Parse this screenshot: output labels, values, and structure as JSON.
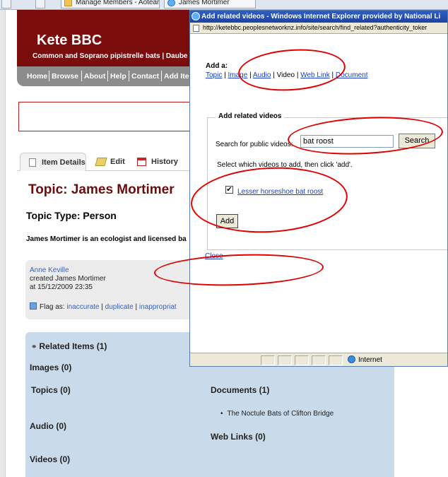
{
  "browser_tabs": [
    {
      "label": "Manage Members - Aotearoa..."
    },
    {
      "label": "James Mortimer"
    }
  ],
  "site": {
    "title": "Kete BBC",
    "subtitle": "Common and Soprano pipistrelle bats | Daube",
    "nav": [
      "Home",
      "Browse",
      "About",
      "Help",
      "Contact",
      "Add Ite"
    ]
  },
  "page_tabs": {
    "details": "Item Details",
    "edit": "Edit",
    "history": "History"
  },
  "topic": {
    "title": "Topic: James Mortimer",
    "type": "Topic Type: Person",
    "description": "James Mortimer is an ecologist and licensed ba"
  },
  "creator": {
    "author": "Anne Keville",
    "created": "created James Mortimer",
    "date": "at 15/12/2009 23:35",
    "flag_label": "Flag as:",
    "flags": [
      "inaccurate",
      "duplicate",
      "inappropriat"
    ]
  },
  "related": {
    "heading": "Related Items (1)",
    "images": "Images (0)",
    "topics": "Topics (0)",
    "audio": "Audio (0)",
    "videos": "Videos (0)",
    "documents": "Documents (1)",
    "document_item": "The Noctule Bats of Clifton Bridge",
    "web_links": "Web Links (0)"
  },
  "popup": {
    "title": "Add related videos - Windows Internet Explorer provided by National Li",
    "address": "http://ketebbc.peoplesnetworknz.info/site/search/find_related?authenticity_toker",
    "add_a": "Add a:",
    "types": [
      "Topic",
      "Image",
      "Audio",
      "Video",
      "Web Link",
      "Document"
    ],
    "current_type": "Video",
    "legend": "Add related videos",
    "search_label": "Search for public videos:",
    "search_value": "bat roost",
    "search_button": "Search",
    "instruction": "Select which videos to add, then click 'add'.",
    "result_checked": true,
    "result_label": "Lesser horseshoe bat roost",
    "add_button": "Add",
    "close_label": "Close",
    "status_zone": "Internet"
  },
  "colors": {
    "header_red": "#7a0c0c",
    "annotation_red": "#e00000",
    "related_blue": "#c9daea",
    "link_blue": "#1a3fc2"
  }
}
